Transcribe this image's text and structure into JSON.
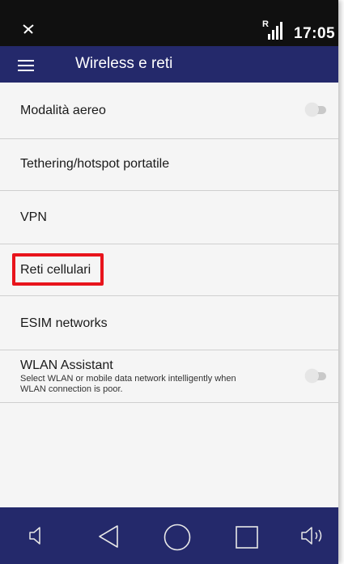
{
  "status_bar": {
    "time": "17:05",
    "roaming_indicator": "R",
    "icons": [
      "notification-muted-icon",
      "signal-icon"
    ]
  },
  "app_bar": {
    "title": "Wireless e reti",
    "menu_icon": "hamburger-menu-icon"
  },
  "settings": {
    "items": [
      {
        "label": "Modalità aereo",
        "toggle": false
      },
      {
        "label": "Tethering/hotspot portatile"
      },
      {
        "label": "VPN"
      },
      {
        "label": "Reti cellulari",
        "highlighted": true
      },
      {
        "label": "ESIM networks"
      },
      {
        "label": "WLAN Assistant",
        "description": "Select WLAN or mobile data network intelligently when WLAN connection is poor.",
        "toggle": false
      }
    ]
  },
  "nav_bar": {
    "icons": [
      "volume-down-icon",
      "back-icon",
      "home-icon",
      "recents-icon",
      "volume-up-icon"
    ]
  },
  "colors": {
    "app_bar": "#24296b",
    "status_bar": "#101010",
    "highlight": "#e8141c",
    "background": "#f5f5f5"
  }
}
